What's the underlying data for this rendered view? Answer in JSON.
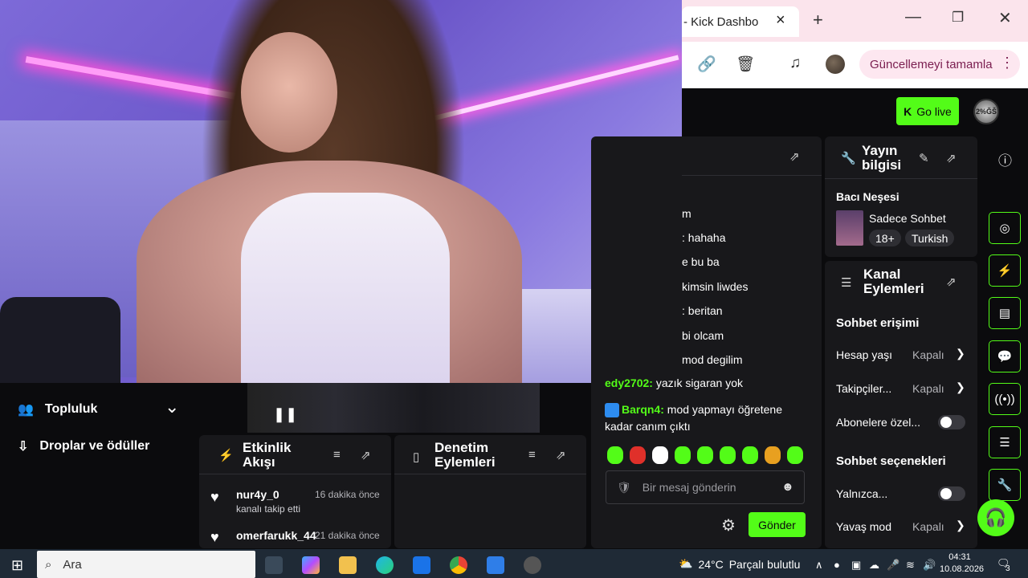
{
  "browser": {
    "tab_title": "- Kick Dashbo",
    "tab_close": "×",
    "new_tab": "+",
    "window_min": "—",
    "window_max": "❐",
    "window_close": "✕",
    "toolbar_icons": {
      "link": "🔗",
      "trash": "🗑",
      "playlist": "♫"
    },
    "update_button": "Güncellemeyi tamamla",
    "menu": "⋮"
  },
  "kick_header": {
    "go_live_logo": "K",
    "go_live": "Go live",
    "profile_initials": "2%ĞŠ"
  },
  "left_nav": {
    "community": "Topluluk",
    "community_chevron": "⌄",
    "drops": "Droplar ve ödüller"
  },
  "chat": {
    "lines": [
      {
        "user": "",
        "text": "m"
      },
      {
        "user": "",
        "text": ": hahaha"
      },
      {
        "user": "",
        "text": "e bu ba"
      },
      {
        "user": "",
        "text": "kimsin liwdes"
      },
      {
        "user": "",
        "text": ": beritan"
      },
      {
        "user": "",
        "text": "bi olcam"
      },
      {
        "user": "",
        "text": "mod degilim"
      }
    ],
    "line_user": "edy2702:",
    "line_text": "yazık sigaran yok",
    "q_user": "Barqn4:",
    "q_text": "mod yapmayı öğretene kadar canım çıktı",
    "input_placeholder": "Bir mesaj gönderin",
    "send": "Gönder",
    "emote_colors": [
      "#53fc18",
      "#e0302a",
      "#ffffff",
      "#53fc18",
      "#53fc18",
      "#53fc18",
      "#53fc18",
      "#e8a020",
      "#53fc18"
    ]
  },
  "stream_info": {
    "title": "Yayın bilgisi",
    "stream_name": "Bacı Neşesi",
    "category": "Sadece Sohbet",
    "tags": [
      "18+",
      "Turkish"
    ]
  },
  "channel_actions": {
    "title": "Kanal Eylemleri",
    "chat_access": "Sohbet erişimi",
    "account_age": "Hesap yaşı",
    "account_age_val": "Kapalı",
    "followers": "Takipçiler...",
    "followers_val": "Kapalı",
    "subscribers": "Abonelere özel...",
    "chat_options": "Sohbet seçenekleri",
    "only": "Yalnızca...",
    "slow_mode": "Yavaş mod",
    "slow_mode_val": "Kapalı"
  },
  "activity": {
    "title": "Etkinlik Akışı",
    "events": [
      {
        "user": "nur4y_0",
        "time": "16 dakika önce",
        "sub": "kanalı takip etti"
      },
      {
        "user": "omerfarukk_44",
        "time": "21 dakika önce",
        "sub": ""
      }
    ]
  },
  "moderation": {
    "title": "Denetim Eylemleri"
  },
  "taskbar": {
    "search": "Ara",
    "weather_temp": "24°C",
    "weather_desc": "Parçalı bulutlu",
    "time": "04:31",
    "date": "10.08.2026",
    "notifications": "3"
  },
  "colors": {
    "accent": "#53fc18",
    "panel": "#18181b",
    "bg": "#0b0b0d"
  }
}
